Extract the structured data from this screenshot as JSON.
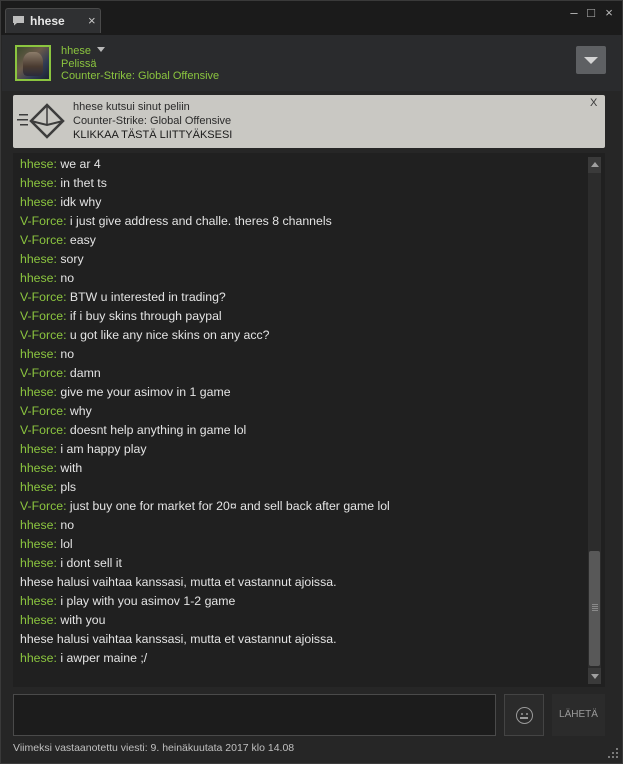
{
  "tab": {
    "label": "hhese",
    "close": "×"
  },
  "window_controls": {
    "minimize": "‒",
    "maximize": "□",
    "close": "×"
  },
  "header": {
    "name": "hhese",
    "status": "Pelissä",
    "game": "Counter-Strike: Global Offensive"
  },
  "invite": {
    "line1": "hhese kutsui sinut peliin",
    "line2": "Counter-Strike: Global Offensive",
    "line3": "KLIKKAA TÄSTÄ LIITTYÄKSESI",
    "close": "X"
  },
  "messages": [
    {
      "sender": "hhese",
      "text": "we ar 4"
    },
    {
      "sender": "hhese",
      "text": "in thet ts"
    },
    {
      "sender": "hhese",
      "text": "idk why"
    },
    {
      "sender": "V-Force",
      "text": "i just give address and challe. theres 8 channels"
    },
    {
      "sender": "V-Force",
      "text": "easy"
    },
    {
      "sender": "hhese",
      "text": "sory"
    },
    {
      "sender": "hhese",
      "text": "no"
    },
    {
      "sender": "V-Force",
      "text": "BTW u interested in trading?"
    },
    {
      "sender": "V-Force",
      "text": "if i buy skins through paypal"
    },
    {
      "sender": "V-Force",
      "text": "u got like any nice skins on any acc?"
    },
    {
      "sender": "hhese",
      "text": "no"
    },
    {
      "sender": "V-Force",
      "text": "damn"
    },
    {
      "sender": "hhese",
      "text": "give me your asimov in 1 game"
    },
    {
      "sender": "V-Force",
      "text": "why"
    },
    {
      "sender": "V-Force",
      "text": "doesnt help anything in game lol"
    },
    {
      "sender": "hhese",
      "text": "i am happy play"
    },
    {
      "sender": "hhese",
      "text": "with"
    },
    {
      "sender": "hhese",
      "text": "pls"
    },
    {
      "sender": "V-Force",
      "text": "just buy one for market for 20¤ and sell back after game lol"
    },
    {
      "sender": "hhese",
      "text": "no"
    },
    {
      "sender": "hhese",
      "text": "lol"
    },
    {
      "sender": "hhese",
      "text": "i dont sell it"
    },
    {
      "sender": "",
      "text": "hhese halusi vaihtaa kanssasi, mutta et vastannut ajoissa."
    },
    {
      "sender": "hhese",
      "text": "i play with you asimov 1-2 game"
    },
    {
      "sender": "hhese",
      "text": "with you"
    },
    {
      "sender": "",
      "text": "hhese halusi vaihtaa kanssasi, mutta et vastannut ajoissa."
    },
    {
      "sender": "hhese",
      "text": "i awper maine ;/"
    }
  ],
  "compose": {
    "send_label": "LÄHETÄ"
  },
  "footer": {
    "last_message": "Viimeksi vastaanotettu viesti: 9. heinäkuutata 2017 klo 14.08"
  },
  "colors": {
    "name_green": "#8bc53f",
    "background": "#262626",
    "chat_bg": "#202020",
    "banner_bg": "#c9c8c3"
  },
  "icons": [
    "chat-bubble-icon",
    "invite-envelope-icon",
    "emoji-icon",
    "dropdown-chevron-icon",
    "resize-grip-icon"
  ]
}
